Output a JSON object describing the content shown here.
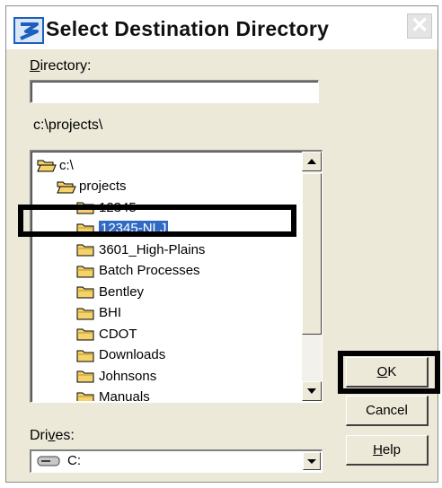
{
  "window": {
    "title": "Select Destination Directory",
    "close_glyph": "✕"
  },
  "directory": {
    "label": "Directory:",
    "label_accel": "D",
    "label_rest": "irectory:",
    "value": ""
  },
  "current_path": "c:\\projects\\",
  "tree": {
    "items": [
      {
        "label": "c:\\",
        "icon": "open-folder-icon",
        "indent": 0
      },
      {
        "label": "projects",
        "icon": "open-folder-icon",
        "indent": 1
      },
      {
        "label": "12345",
        "icon": "folder-icon",
        "indent": 2
      },
      {
        "label": "12345-NLJ",
        "icon": "folder-icon",
        "indent": 2,
        "selected": true
      },
      {
        "label": "3601_High-Plains",
        "icon": "folder-icon",
        "indent": 2
      },
      {
        "label": "Batch Processes",
        "icon": "folder-icon",
        "indent": 2
      },
      {
        "label": "Bentley",
        "icon": "folder-icon",
        "indent": 2
      },
      {
        "label": "BHI",
        "icon": "folder-icon",
        "indent": 2
      },
      {
        "label": "CDOT",
        "icon": "folder-icon",
        "indent": 2
      },
      {
        "label": "Downloads",
        "icon": "folder-icon",
        "indent": 2
      },
      {
        "label": "Johnsons",
        "icon": "folder-icon",
        "indent": 2
      },
      {
        "label": "Manuals",
        "icon": "folder-icon",
        "indent": 2
      }
    ]
  },
  "drives": {
    "label_accel_prefix": "Dri",
    "label_accel": "v",
    "label_rest": "es:",
    "selected": "C:",
    "icon": "drive-icon"
  },
  "buttons": {
    "ok": {
      "accel": "O",
      "rest": "K"
    },
    "cancel": {
      "label": "Cancel"
    },
    "help": {
      "accel": "H",
      "rest": "elp"
    }
  },
  "colors": {
    "dialog_bg": "#ece9d8",
    "selection": "#316ac5",
    "folder": "#f5d36a",
    "title_icon": "#1b5fc1"
  }
}
